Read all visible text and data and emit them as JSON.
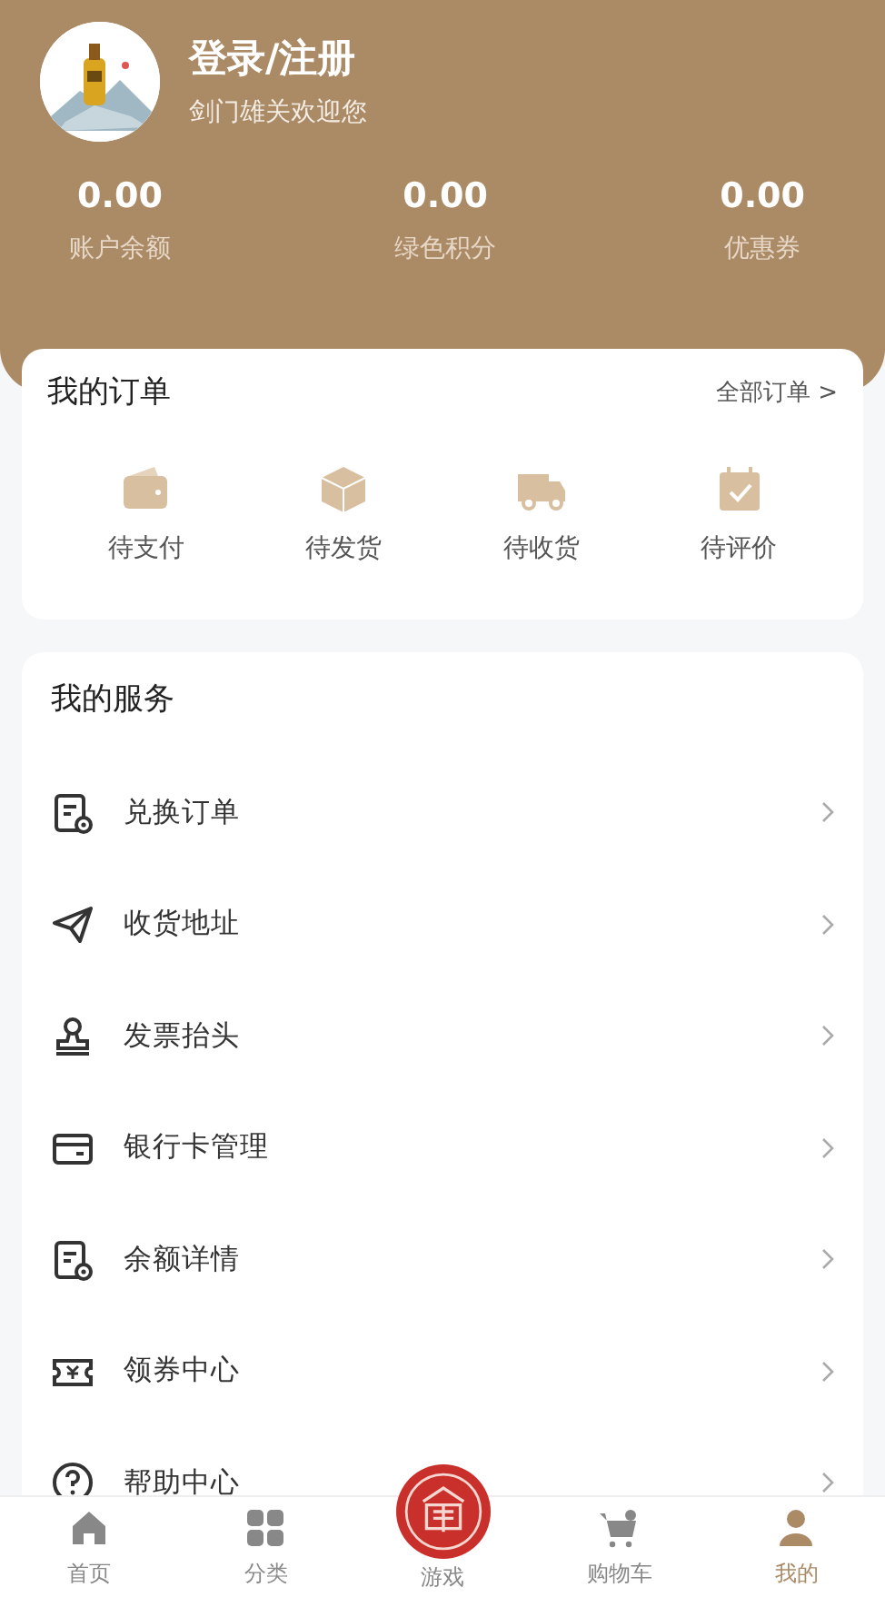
{
  "profile": {
    "title": "登录/注册",
    "subtitle": "剑门雄关欢迎您"
  },
  "stats": [
    {
      "value": "0.00",
      "label": "账户余额"
    },
    {
      "value": "0.00",
      "label": "绿色积分"
    },
    {
      "value": "0.00",
      "label": "优惠券"
    }
  ],
  "orders": {
    "title": "我的订单",
    "more": "全部订单",
    "more_arrow": ">",
    "items": [
      {
        "kind": "wallet",
        "label": "待支付"
      },
      {
        "kind": "box",
        "label": "待发货"
      },
      {
        "kind": "truck",
        "label": "待收货"
      },
      {
        "kind": "calendar",
        "label": "待评价"
      }
    ]
  },
  "services": {
    "title": "我的服务",
    "items": [
      {
        "kind": "doc",
        "label": "兑换订单"
      },
      {
        "kind": "plane",
        "label": "收货地址"
      },
      {
        "kind": "stamp",
        "label": "发票抬头"
      },
      {
        "kind": "card",
        "label": "银行卡管理"
      },
      {
        "kind": "doc",
        "label": "余额详情"
      },
      {
        "kind": "ticket",
        "label": "领券中心"
      },
      {
        "kind": "help",
        "label": "帮助中心"
      }
    ]
  },
  "tab_bar": [
    {
      "kind": "home",
      "label": "首页",
      "selected": false
    },
    {
      "kind": "grid",
      "label": "分类",
      "selected": false
    },
    {
      "kind": "center",
      "label": "游戏",
      "selected": false
    },
    {
      "kind": "cart",
      "label": "购物车",
      "selected": false
    },
    {
      "kind": "user",
      "label": "我的",
      "selected": true
    }
  ]
}
